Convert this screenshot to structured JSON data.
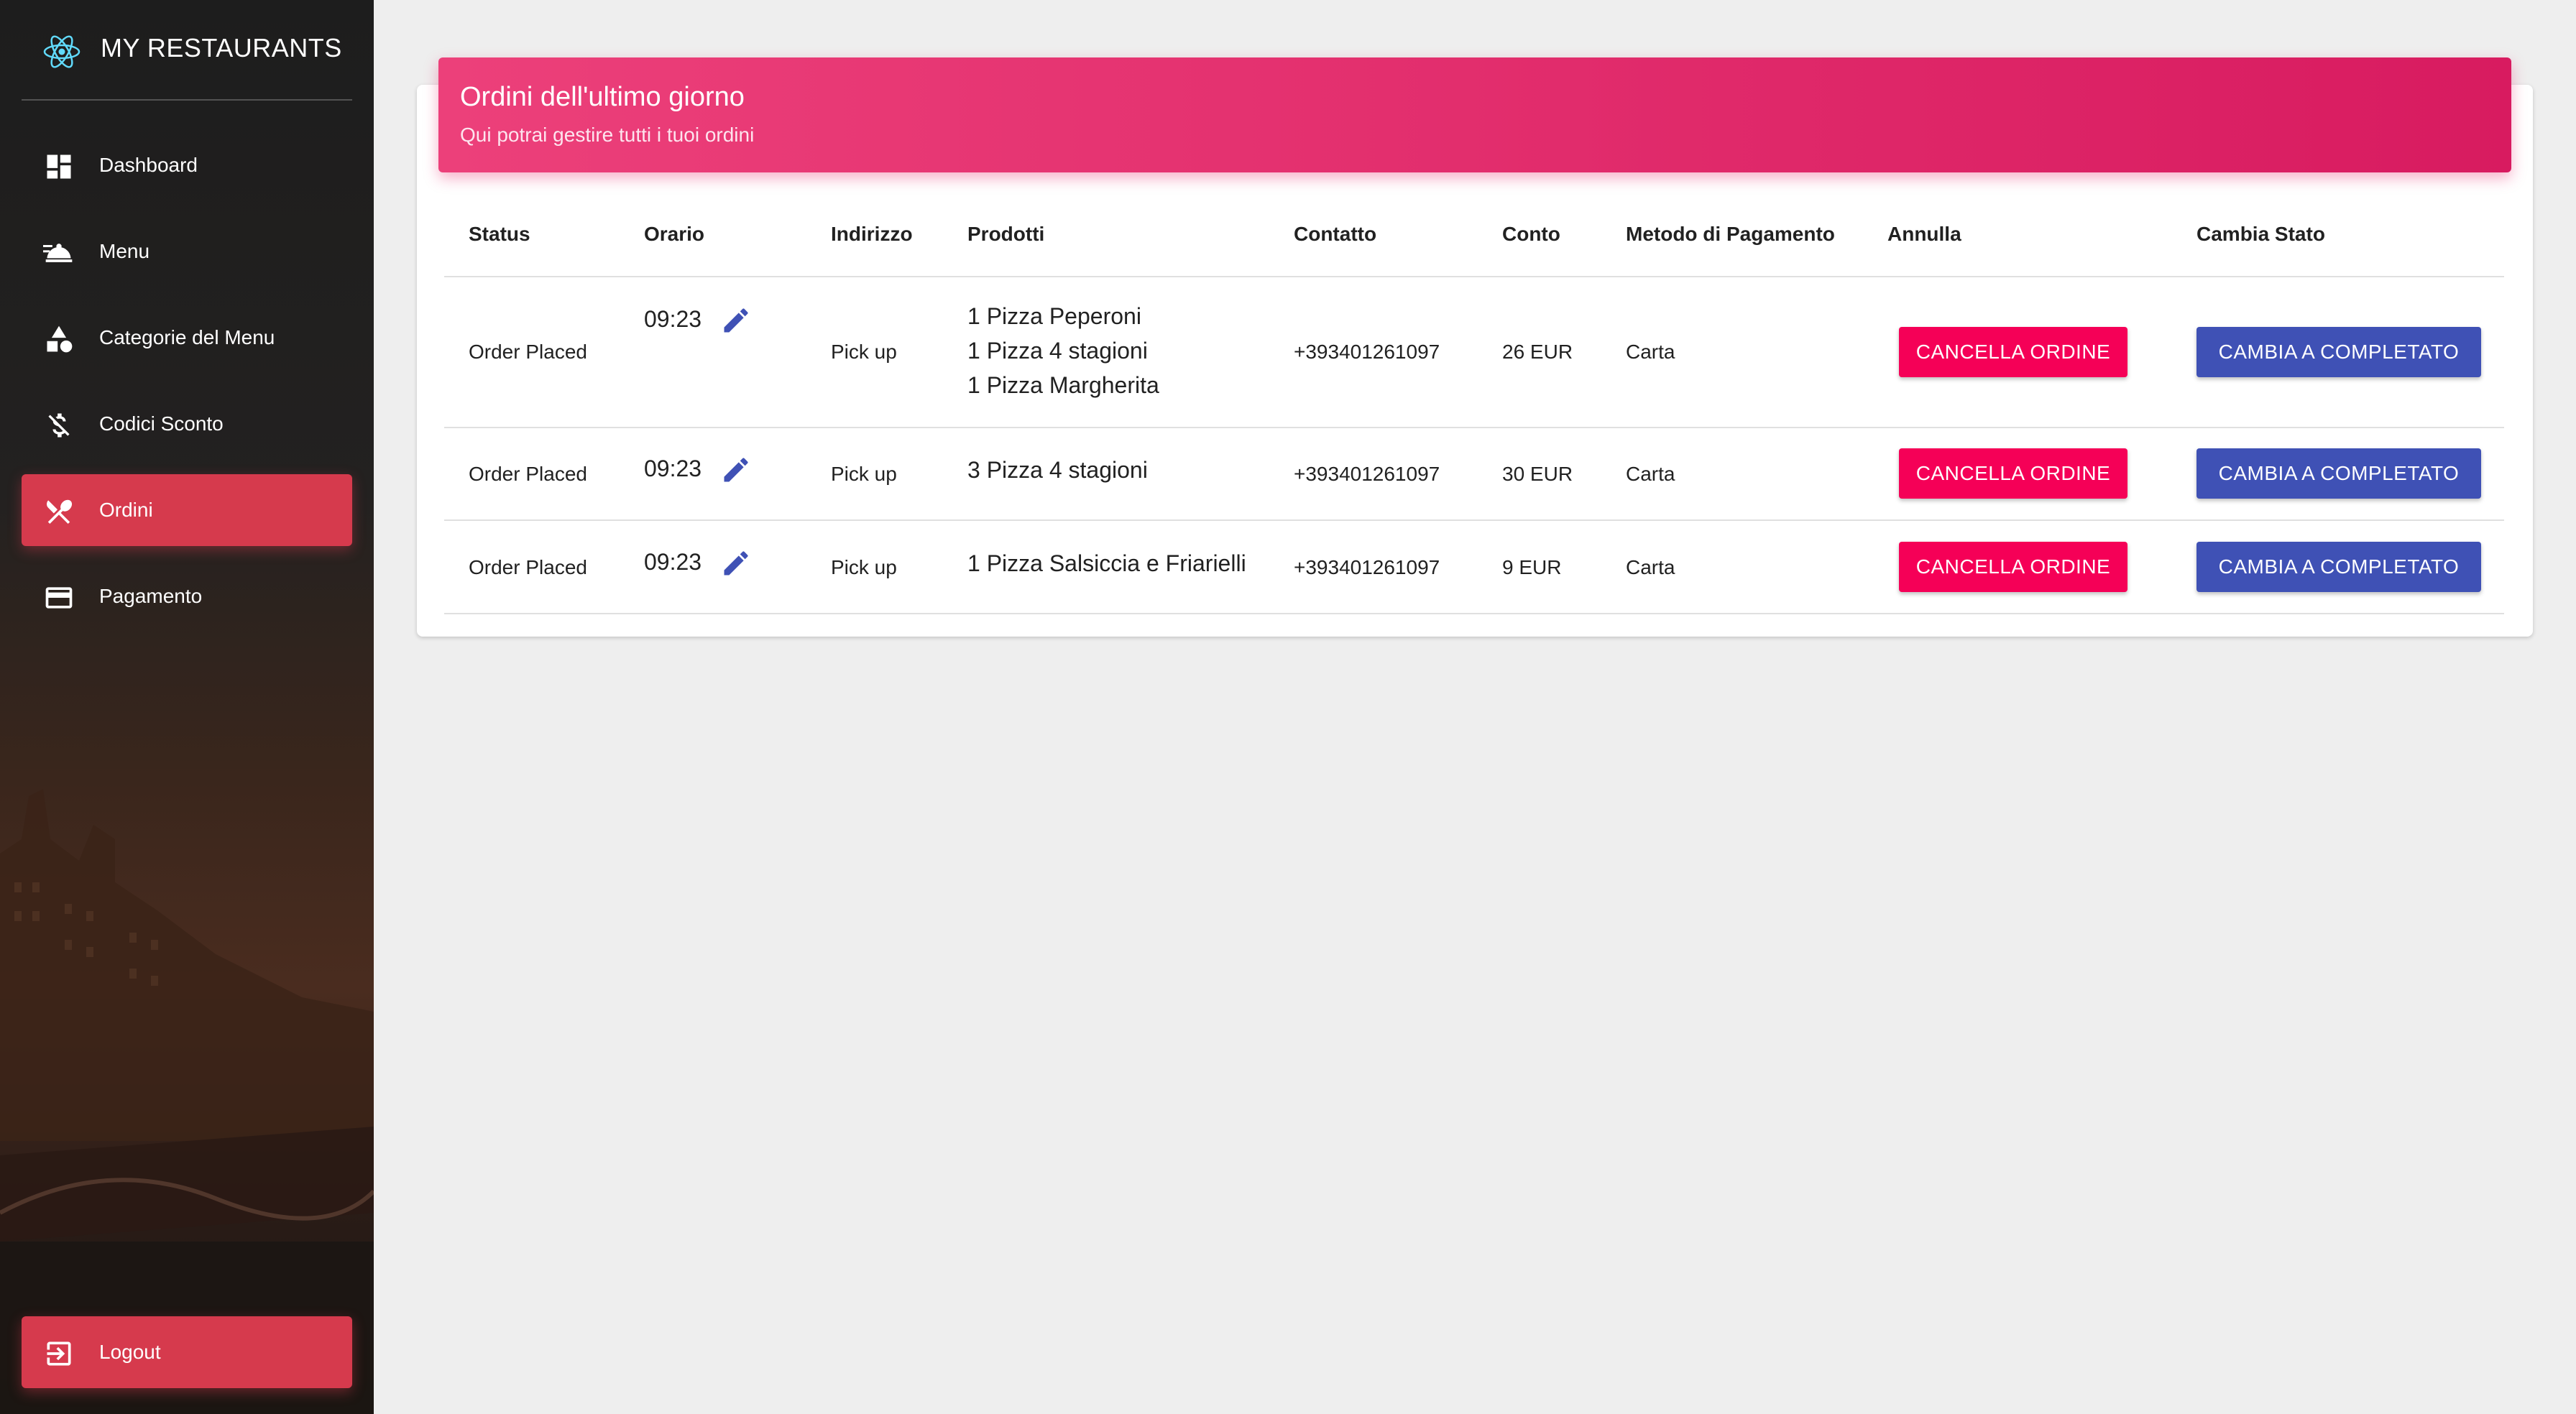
{
  "app": {
    "title": "MY RESTAURANTS",
    "logo_icon": "react-atom-icon"
  },
  "sidebar": {
    "items": [
      {
        "label": "Dashboard",
        "icon": "dashboard-icon",
        "active": false
      },
      {
        "label": "Menu",
        "icon": "room-service-icon",
        "active": false
      },
      {
        "label": "Categorie del Menu",
        "icon": "category-icon",
        "active": false
      },
      {
        "label": "Codici Sconto",
        "icon": "money-off-icon",
        "active": false
      },
      {
        "label": "Ordini",
        "icon": "restaurant-icon",
        "active": true
      },
      {
        "label": "Pagamento",
        "icon": "credit-card-icon",
        "active": false
      }
    ],
    "logout": {
      "label": "Logout",
      "icon": "exit-icon"
    },
    "active_color": "#d63a4d"
  },
  "card": {
    "title": "Ordini dell'ultimo giorno",
    "subtitle": "Qui potrai gestire tutti i tuoi ordini",
    "header_color": "#e91e63"
  },
  "table": {
    "columns": [
      "Status",
      "Orario",
      "Indirizzo",
      "Prodotti",
      "Contatto",
      "Conto",
      "Metodo di Pagamento",
      "Annulla",
      "Cambia Stato"
    ],
    "rows": [
      {
        "status": "Order Placed",
        "time": "09:23",
        "address": "Pick up",
        "products": [
          "1 Pizza Peperoni",
          "1 Pizza 4 stagioni",
          "1 Pizza Margherita"
        ],
        "contact": "+393401261097",
        "total": "26 EUR",
        "payment": "Carta",
        "cancel_label": "CANCELLA ORDINE",
        "change_label": "CAMBIA A COMPLETATO"
      },
      {
        "status": "Order Placed",
        "time": "09:23",
        "address": "Pick up",
        "products": [
          "3 Pizza 4 stagioni"
        ],
        "contact": "+393401261097",
        "total": "30 EUR",
        "payment": "Carta",
        "cancel_label": "CANCELLA ORDINE",
        "change_label": "CAMBIA A COMPLETATO"
      },
      {
        "status": "Order Placed",
        "time": "09:23",
        "address": "Pick up",
        "products": [
          "1 Pizza Salsiccia e Friarielli"
        ],
        "contact": "+393401261097",
        "total": "9 EUR",
        "payment": "Carta",
        "cancel_label": "CANCELLA ORDINE",
        "change_label": "CAMBIA A COMPLETATO"
      }
    ],
    "edit_icon": "pencil-icon",
    "cancel_color": "#f50057",
    "change_color": "#3f51b5"
  }
}
